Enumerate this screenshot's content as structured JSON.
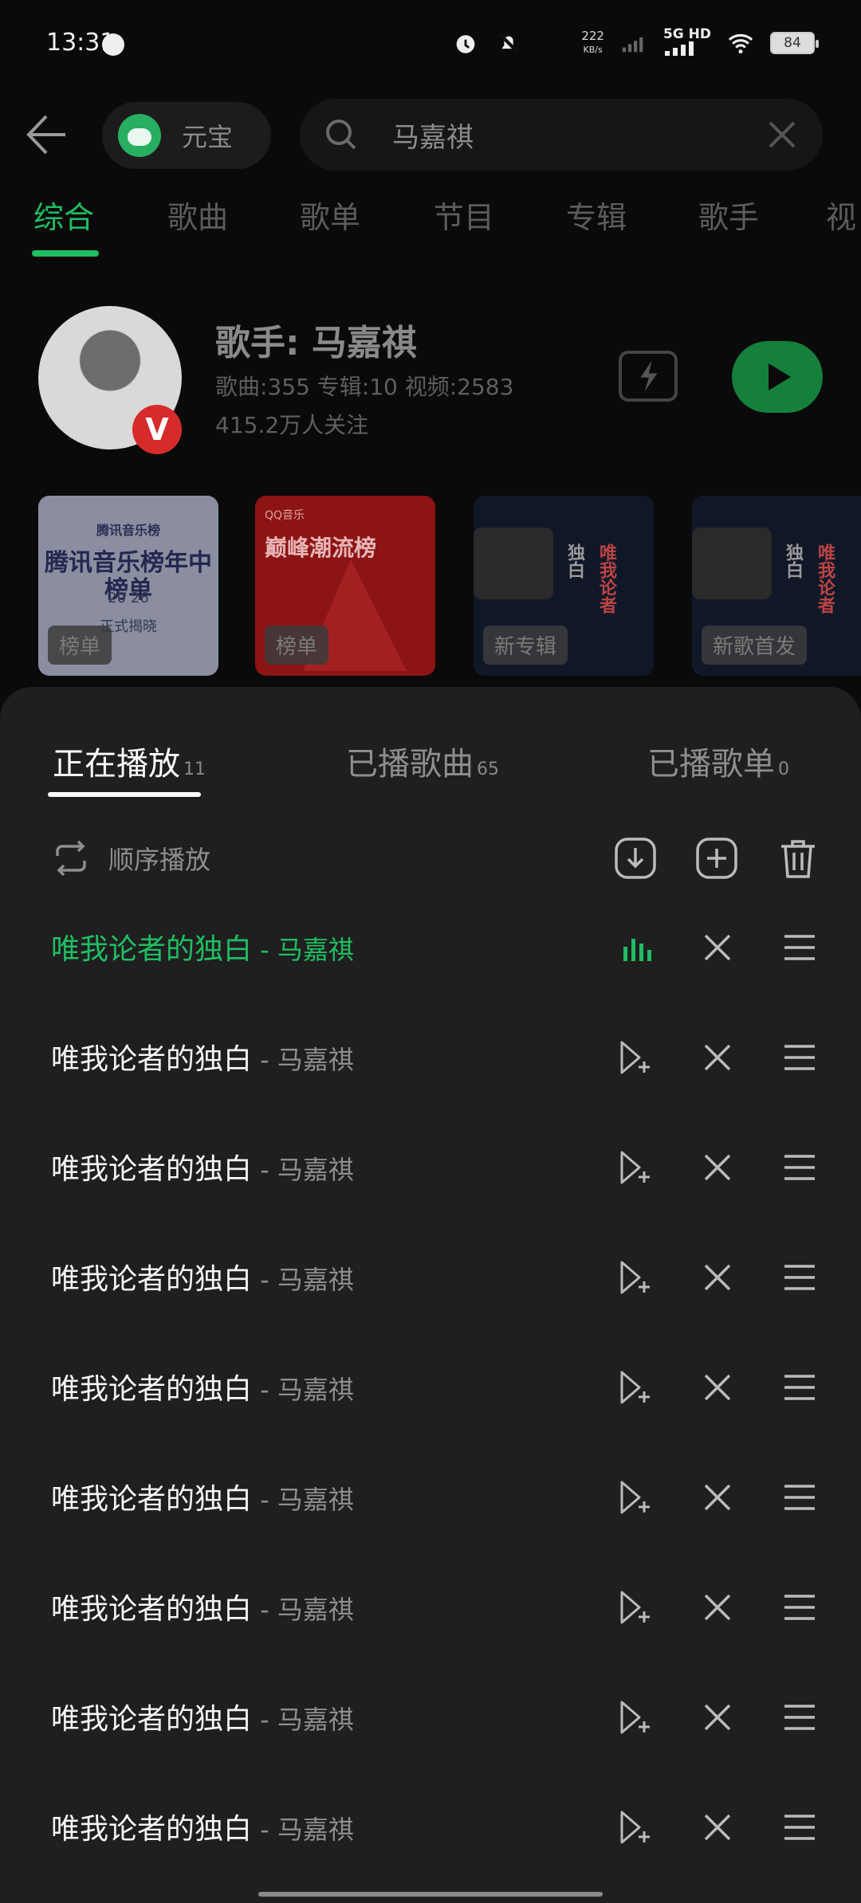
{
  "status_bar": {
    "time": "13:31",
    "net_speed_value": "222",
    "net_speed_unit": "KB/s",
    "network": "5G HD",
    "battery": "84"
  },
  "search": {
    "assistant_label": "元宝",
    "query": "马嘉祺"
  },
  "tabs": [
    "综合",
    "歌曲",
    "歌单",
    "节目",
    "专辑",
    "歌手",
    "视"
  ],
  "artist": {
    "name": "歌手: 马嘉祺",
    "stats": "歌曲:355 专辑:10 视频:2583",
    "followers": "415.2万人关注",
    "badge": "V"
  },
  "cards": [
    {
      "tag": "榜单",
      "brand": "腾讯音乐榜",
      "title": "腾讯音乐榜年中榜单",
      "year": "20 26",
      "subtitle": "正式揭晓"
    },
    {
      "tag": "榜单",
      "brand": "QQ音乐",
      "title": "巅峰潮流榜"
    },
    {
      "tag": "新专辑",
      "art_text_1": "唯我论者",
      "art_text_2": "独白"
    },
    {
      "tag": "新歌首发",
      "art_text_1": "唯我论者",
      "art_text_2": "独白"
    }
  ],
  "sheet": {
    "tabs": [
      {
        "label": "正在播放",
        "count": "11"
      },
      {
        "label": "已播歌曲",
        "count": "65"
      },
      {
        "label": "已播歌单",
        "count": "0"
      }
    ],
    "mode_label": "顺序播放",
    "songs": [
      {
        "title": "唯我论者的独白",
        "artist": " - 马嘉祺"
      },
      {
        "title": "唯我论者的独白",
        "artist": " - 马嘉祺"
      },
      {
        "title": "唯我论者的独白",
        "artist": " - 马嘉祺"
      },
      {
        "title": "唯我论者的独白",
        "artist": " - 马嘉祺"
      },
      {
        "title": "唯我论者的独白",
        "artist": " - 马嘉祺"
      },
      {
        "title": "唯我论者的独白",
        "artist": " - 马嘉祺"
      },
      {
        "title": "唯我论者的独白",
        "artist": " - 马嘉祺"
      },
      {
        "title": "唯我论者的独白",
        "artist": " - 马嘉祺"
      },
      {
        "title": "唯我论者的独白",
        "artist": " - 马嘉祺"
      }
    ]
  },
  "colors": {
    "accent": "#1fbe63",
    "sheet_bg": "#1f1f1f",
    "page_bg": "#0a0a0a"
  }
}
